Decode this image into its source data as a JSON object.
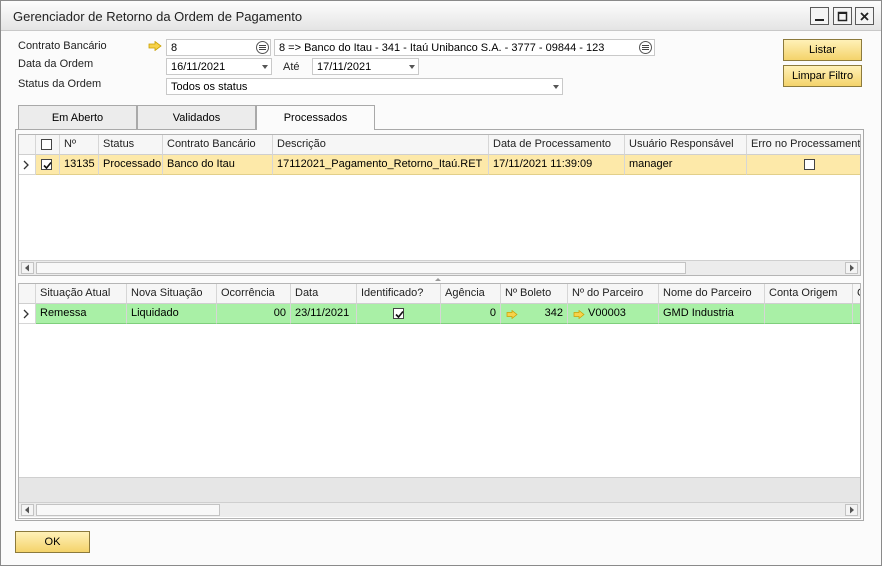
{
  "window": {
    "title": "Gerenciador de Retorno da Ordem de Pagamento",
    "minimize_glyph": "—",
    "maximize_glyph": "☐",
    "close_glyph": "✕"
  },
  "filters": {
    "contrato_label": "Contrato Bancário",
    "contrato_value": "8",
    "contrato_desc": "8 => Banco do Itau - 341 - Itaú Unibanco  S.A. - 3777 - 09844 - 123",
    "data_label": "Data da Ordem",
    "data_from": "16/11/2021",
    "ate_label": "Até",
    "data_to": "17/11/2021",
    "status_label": "Status da Ordem",
    "status_value": "Todos os status"
  },
  "buttons": {
    "listar": "Listar",
    "limpar": "Limpar Filtro",
    "ok": "OK"
  },
  "tabs": [
    "Em Aberto",
    "Validados",
    "Processados"
  ],
  "active_tab": "Processados",
  "grid1": {
    "headers": [
      "",
      "Nº",
      "Status",
      "Contrato Bancário",
      "Descrição",
      "Data de Processamento",
      "Usuário Responsável",
      "Erro no Processamento"
    ],
    "rows": [
      {
        "checked": true,
        "numero": "13135",
        "status": "Processado",
        "contrato": "Banco do Itau",
        "descricao": "17112021_Pagamento_Retorno_Itaú.RET",
        "data": "17/11/2021 11:39:09",
        "usuario": "manager",
        "erro": false
      }
    ]
  },
  "grid2": {
    "headers": [
      "Situação Atual",
      "Nova Situação",
      "Ocorrência",
      "Data",
      "Identificado?",
      "Agência",
      "Nº Boleto",
      "Nº do Parceiro",
      "Nome do Parceiro",
      "Conta Origem",
      "C"
    ],
    "rows": [
      {
        "situacao_atual": "Remessa",
        "nova_situacao": "Liquidado",
        "ocorrencia": "00",
        "data": "23/11/2021",
        "identificado": true,
        "agencia": "0",
        "boleto": "342",
        "parceiro": "V00003",
        "nome_parceiro": "GMD Industria",
        "conta_origem": ""
      }
    ]
  },
  "colors": {
    "selected_row": "#fde9a9",
    "green_row": "#a9f0a6",
    "button_yellow": "#f4d36b",
    "link_arrow": "#e5b300"
  },
  "icons": {
    "link_arrow": "link-arrow-icon",
    "choose_list": "choose-from-list-icon",
    "row_indicator": "row-indicator-icon"
  }
}
